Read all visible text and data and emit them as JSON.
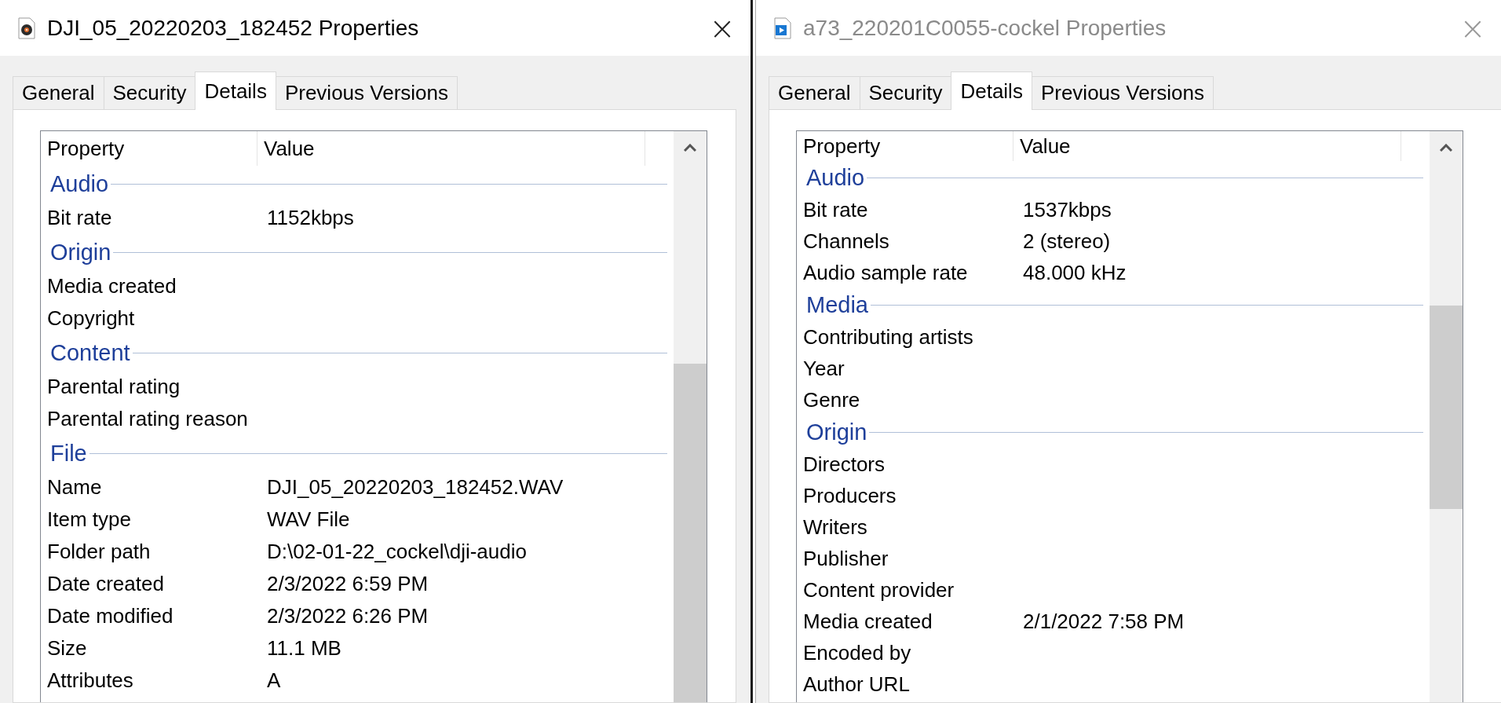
{
  "windows": [
    {
      "title": "DJI_05_20220203_182452 Properties",
      "active": true,
      "close": "×",
      "tabs": [
        {
          "label": "General",
          "selected": false
        },
        {
          "label": "Security",
          "selected": false
        },
        {
          "label": "Details",
          "selected": true
        },
        {
          "label": "Previous Versions",
          "selected": false
        }
      ],
      "columns": [
        "Property",
        "Value"
      ],
      "groups": [
        {
          "heading": "Audio",
          "rows": [
            {
              "property": "Bit rate",
              "value": "1152kbps"
            }
          ]
        },
        {
          "heading": "Origin",
          "rows": [
            {
              "property": "Media created"
            },
            {
              "property": "Copyright"
            }
          ]
        },
        {
          "heading": "Content",
          "rows": [
            {
              "property": "Parental rating"
            },
            {
              "property": "Parental rating reason"
            }
          ]
        },
        {
          "heading": "File",
          "rows": [
            {
              "property": "Name",
              "value": "DJI_05_20220203_182452.WAV"
            },
            {
              "property": "Item type",
              "value": "WAV File"
            },
            {
              "property": "Folder path",
              "value": "D:\\02-01-22_cockel\\dji-audio"
            },
            {
              "property": "Date created",
              "value": "2/3/2022 6:59 PM"
            },
            {
              "property": "Date modified",
              "value": "2/3/2022 6:26 PM"
            },
            {
              "property": "Size",
              "value": "11.1 MB"
            },
            {
              "property": "Attributes",
              "value": "A"
            }
          ]
        }
      ]
    },
    {
      "title": "a73_220201C0055-cockel Properties",
      "active": false,
      "close": "×",
      "tabs": [
        {
          "label": "General",
          "selected": false
        },
        {
          "label": "Security",
          "selected": false
        },
        {
          "label": "Details",
          "selected": true
        },
        {
          "label": "Previous Versions",
          "selected": false
        }
      ],
      "columns": [
        "Property",
        "Value"
      ],
      "groups": [
        {
          "heading": "Audio",
          "rows": [
            {
              "property": "Bit rate",
              "value": "1537kbps"
            },
            {
              "property": "Channels",
              "value": "2 (stereo)"
            },
            {
              "property": "Audio sample rate",
              "value": "48.000 kHz"
            }
          ]
        },
        {
          "heading": "Media",
          "rows": [
            {
              "property": "Contributing artists"
            },
            {
              "property": "Year"
            },
            {
              "property": "Genre"
            }
          ]
        },
        {
          "heading": "Origin",
          "rows": [
            {
              "property": "Directors"
            },
            {
              "property": "Producers"
            },
            {
              "property": "Writers"
            },
            {
              "property": "Publisher"
            },
            {
              "property": "Content provider"
            },
            {
              "property": "Media created",
              "value": "2/1/2022 7:58 PM"
            },
            {
              "property": "Encoded by"
            },
            {
              "property": "Author URL"
            }
          ]
        }
      ]
    }
  ]
}
